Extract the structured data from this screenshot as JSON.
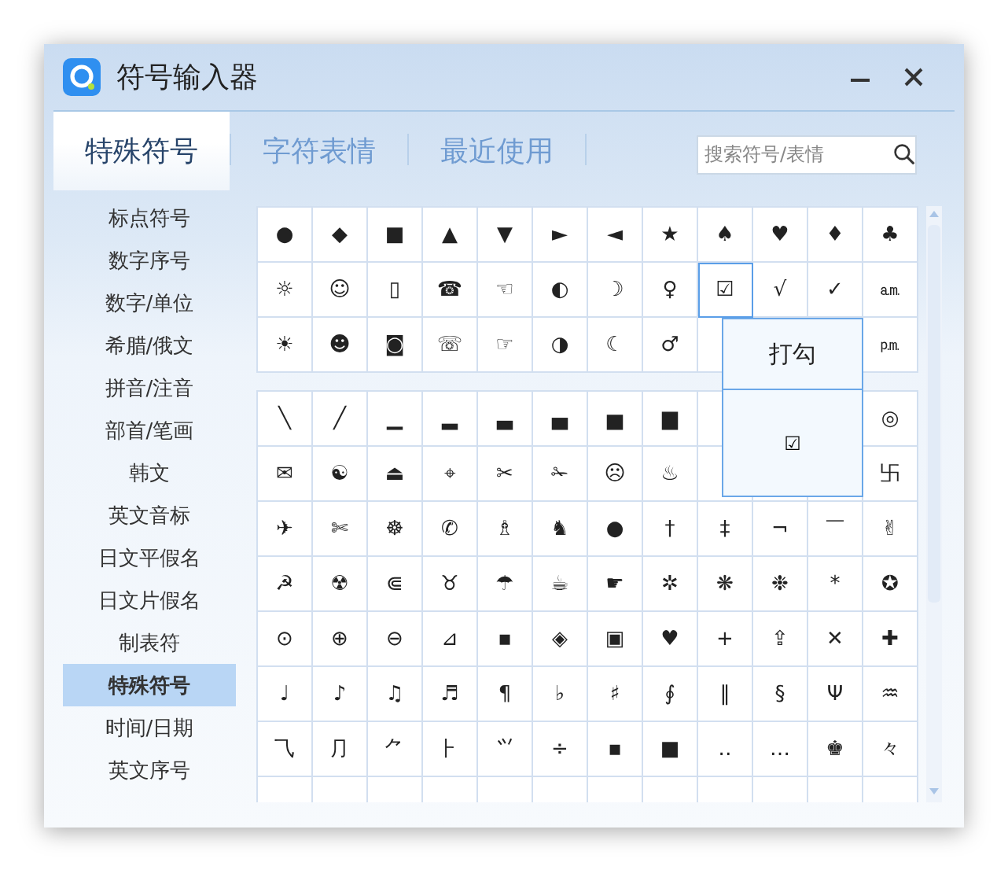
{
  "window": {
    "title": "符号输入器"
  },
  "tabs": [
    {
      "label": "特殊符号",
      "selected": true
    },
    {
      "label": "字符表情",
      "selected": false
    },
    {
      "label": "最近使用",
      "selected": false
    }
  ],
  "search": {
    "placeholder": "搜索符号/表情"
  },
  "sidebar": {
    "items": [
      {
        "label": "标点符号",
        "selected": false
      },
      {
        "label": "数字序号",
        "selected": false
      },
      {
        "label": "数字/单位",
        "selected": false
      },
      {
        "label": "希腊/俄文",
        "selected": false
      },
      {
        "label": "拼音/注音",
        "selected": false
      },
      {
        "label": "部首/笔画",
        "selected": false
      },
      {
        "label": "韩文",
        "selected": false
      },
      {
        "label": "英文音标",
        "selected": false
      },
      {
        "label": "日文平假名",
        "selected": false
      },
      {
        "label": "日文片假名",
        "selected": false
      },
      {
        "label": "制表符",
        "selected": false
      },
      {
        "label": "特殊符号",
        "selected": true
      },
      {
        "label": "时间/日期",
        "selected": false
      },
      {
        "label": "英文序号",
        "selected": false
      }
    ]
  },
  "grid": {
    "sections": [
      {
        "rows": [
          [
            {
              "symbol": "●",
              "hovered": false
            },
            {
              "symbol": "◆",
              "hovered": false
            },
            {
              "symbol": "■",
              "hovered": false
            },
            {
              "symbol": "▲",
              "hovered": false
            },
            {
              "symbol": "▼",
              "hovered": false
            },
            {
              "symbol": "►",
              "hovered": false
            },
            {
              "symbol": "◄",
              "hovered": false
            },
            {
              "symbol": "★",
              "hovered": false
            },
            {
              "symbol": "♠",
              "hovered": false
            },
            {
              "symbol": "♥",
              "hovered": false
            },
            {
              "symbol": "♦",
              "hovered": false
            },
            {
              "symbol": "♣",
              "hovered": false
            }
          ],
          [
            {
              "symbol": "☼",
              "hovered": false
            },
            {
              "symbol": "☺",
              "hovered": false
            },
            {
              "symbol": "▯",
              "hovered": false
            },
            {
              "symbol": "☎",
              "hovered": false
            },
            {
              "symbol": "☜",
              "hovered": false
            },
            {
              "symbol": "◐",
              "hovered": false
            },
            {
              "symbol": "☽",
              "hovered": false
            },
            {
              "symbol": "♀",
              "hovered": false
            },
            {
              "symbol": "☑",
              "hovered": true
            },
            {
              "symbol": "√",
              "hovered": false
            },
            {
              "symbol": "✓",
              "hovered": false
            },
            {
              "symbol": "㏂",
              "hovered": false
            }
          ],
          [
            {
              "symbol": "☀",
              "hovered": false
            },
            {
              "symbol": "☻",
              "hovered": false
            },
            {
              "symbol": "◙",
              "hovered": false
            },
            {
              "symbol": "☏",
              "hovered": false
            },
            {
              "symbol": "☞",
              "hovered": false
            },
            {
              "symbol": "◑",
              "hovered": false
            },
            {
              "symbol": "☾",
              "hovered": false
            },
            {
              "symbol": "♂",
              "hovered": false
            },
            null,
            null,
            null,
            {
              "symbol": "㏘",
              "hovered": false
            }
          ]
        ]
      },
      {
        "rows": [
          [
            {
              "symbol": "╲",
              "hovered": false
            },
            {
              "symbol": "╱",
              "hovered": false
            },
            {
              "symbol": "▁",
              "hovered": false
            },
            {
              "symbol": "▂",
              "hovered": false
            },
            {
              "symbol": "▃",
              "hovered": false
            },
            {
              "symbol": "▄",
              "hovered": false
            },
            {
              "symbol": "▅",
              "hovered": false
            },
            {
              "symbol": "▆",
              "hovered": false
            },
            null,
            null,
            null,
            {
              "symbol": "◎",
              "hovered": false
            }
          ],
          [
            {
              "symbol": "✉",
              "hovered": false
            },
            {
              "symbol": "☯",
              "hovered": false
            },
            {
              "symbol": "⏏",
              "hovered": false
            },
            {
              "symbol": "⌖",
              "hovered": false
            },
            {
              "symbol": "✂",
              "hovered": false
            },
            {
              "symbol": "✁",
              "hovered": false
            },
            {
              "symbol": "☹",
              "hovered": false
            },
            {
              "symbol": "♨",
              "hovered": false
            },
            null,
            null,
            null,
            {
              "symbol": "卐",
              "hovered": false
            }
          ],
          [
            {
              "symbol": "✈",
              "hovered": false
            },
            {
              "symbol": "✄",
              "hovered": false
            },
            {
              "symbol": "☸",
              "hovered": false
            },
            {
              "symbol": "✆",
              "hovered": false
            },
            {
              "symbol": "♗",
              "hovered": false
            },
            {
              "symbol": "♞",
              "hovered": false
            },
            {
              "symbol": "●",
              "hovered": false
            },
            {
              "symbol": "†",
              "hovered": false
            },
            {
              "symbol": "‡",
              "hovered": false
            },
            {
              "symbol": "¬",
              "hovered": false
            },
            {
              "symbol": "￣",
              "hovered": false
            },
            {
              "symbol": "✌",
              "hovered": false
            }
          ],
          [
            {
              "symbol": "☭",
              "hovered": false
            },
            {
              "symbol": "☢",
              "hovered": false
            },
            {
              "symbol": "⋐",
              "hovered": false
            },
            {
              "symbol": "♉",
              "hovered": false
            },
            {
              "symbol": "☂",
              "hovered": false
            },
            {
              "symbol": "☕",
              "hovered": false
            },
            {
              "symbol": "☛",
              "hovered": false
            },
            {
              "symbol": "✲",
              "hovered": false
            },
            {
              "symbol": "❋",
              "hovered": false
            },
            {
              "symbol": "❉",
              "hovered": false
            },
            {
              "symbol": "*",
              "hovered": false
            },
            {
              "symbol": "✪",
              "hovered": false
            }
          ],
          [
            {
              "symbol": "⊙",
              "hovered": false
            },
            {
              "symbol": "⊕",
              "hovered": false
            },
            {
              "symbol": "⊖",
              "hovered": false
            },
            {
              "symbol": "⊿",
              "hovered": false
            },
            {
              "symbol": "▪",
              "hovered": false
            },
            {
              "symbol": "◈",
              "hovered": false
            },
            {
              "symbol": "▣",
              "hovered": false
            },
            {
              "symbol": "♥",
              "hovered": false
            },
            {
              "symbol": "+",
              "hovered": false
            },
            {
              "symbol": "⇪",
              "hovered": false
            },
            {
              "symbol": "✕",
              "hovered": false
            },
            {
              "symbol": "✚",
              "hovered": false
            }
          ],
          [
            {
              "symbol": "♩",
              "hovered": false
            },
            {
              "symbol": "♪",
              "hovered": false
            },
            {
              "symbol": "♫",
              "hovered": false
            },
            {
              "symbol": "♬",
              "hovered": false
            },
            {
              "symbol": "¶",
              "hovered": false
            },
            {
              "symbol": "♭",
              "hovered": false
            },
            {
              "symbol": "♯",
              "hovered": false
            },
            {
              "symbol": "∮",
              "hovered": false
            },
            {
              "symbol": "‖",
              "hovered": false
            },
            {
              "symbol": "§",
              "hovered": false
            },
            {
              "symbol": "Ψ",
              "hovered": false
            },
            {
              "symbol": "♒",
              "hovered": false
            }
          ],
          [
            {
              "symbol": "⺄",
              "hovered": false
            },
            {
              "symbol": "⺆",
              "hovered": false
            },
            {
              "symbol": "⺈",
              "hovered": false
            },
            {
              "symbol": "⺊",
              "hovered": false
            },
            {
              "symbol": "⺍",
              "hovered": false
            },
            {
              "symbol": "÷",
              "hovered": false
            },
            {
              "symbol": "▪",
              "hovered": false
            },
            {
              "symbol": "■",
              "hovered": false
            },
            {
              "symbol": "‥",
              "hovered": false
            },
            {
              "symbol": "…",
              "hovered": false
            },
            {
              "symbol": "♚",
              "hovered": false
            },
            {
              "symbol": "々",
              "hovered": false
            }
          ]
        ]
      }
    ]
  },
  "tooltip": {
    "name": "打勾",
    "symbol": "☑"
  }
}
